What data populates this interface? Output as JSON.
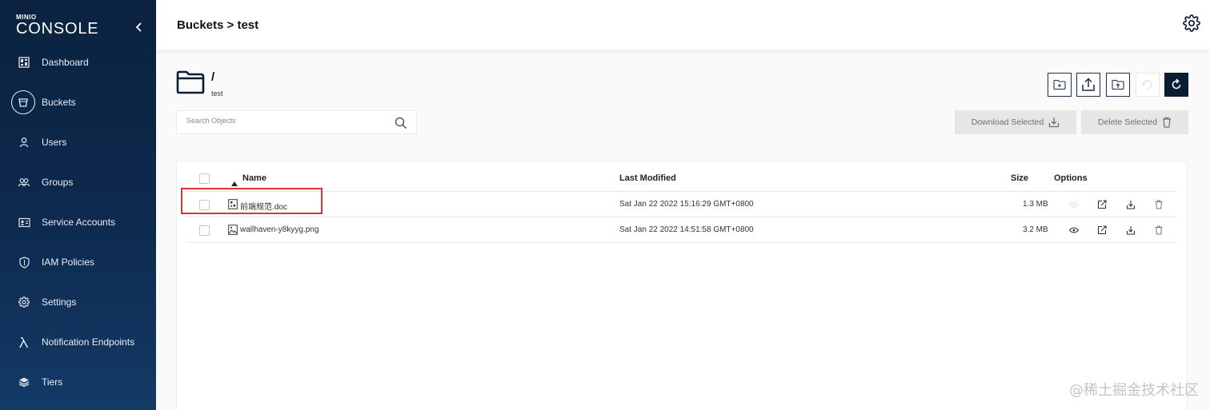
{
  "app": {
    "logo_small": "MINIO",
    "logo_big": "CONSOLE"
  },
  "sidebar": {
    "items": [
      {
        "label": "Dashboard",
        "icon": "dashboard-icon"
      },
      {
        "label": "Buckets",
        "icon": "bucket-icon",
        "active": true
      },
      {
        "label": "Users",
        "icon": "user-icon"
      },
      {
        "label": "Groups",
        "icon": "groups-icon"
      },
      {
        "label": "Service Accounts",
        "icon": "id-card-icon"
      },
      {
        "label": "IAM Policies",
        "icon": "shield-icon"
      },
      {
        "label": "Settings",
        "icon": "gear-icon"
      },
      {
        "label": "Notification Endpoints",
        "icon": "lambda-icon"
      },
      {
        "label": "Tiers",
        "icon": "layers-icon"
      }
    ]
  },
  "header": {
    "breadcrumb": "Buckets > test"
  },
  "folder": {
    "path": "/",
    "bucket": "test"
  },
  "search": {
    "placeholder": "Search Objects"
  },
  "actions": {
    "download_selected": "Download Selected",
    "delete_selected": "Delete Selected"
  },
  "table": {
    "headers": {
      "name": "Name",
      "last_modified": "Last Modified",
      "size": "Size",
      "options": "Options"
    },
    "rows": [
      {
        "name": "前端规范.doc",
        "last_modified": "Sat Jan 22 2022 15:16:29 GMT+0800",
        "size": "1.3 MB",
        "preview_enabled": false
      },
      {
        "name": "wallhaven-y8kyyg.png",
        "last_modified": "Sat Jan 22 2022 14:51:58 GMT+0800",
        "size": "3.2 MB",
        "preview_enabled": true
      }
    ]
  },
  "colors": {
    "sidebar_bg": "#0e2a4f",
    "accent_dark": "#0a1b34",
    "highlight": "#e23131"
  },
  "watermark": "@稀土掘金技术社区"
}
